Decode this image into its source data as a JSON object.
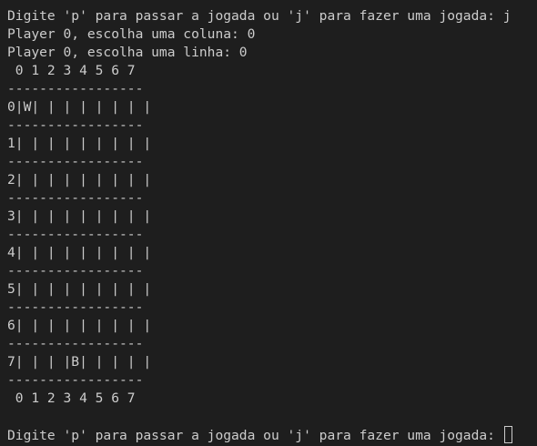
{
  "terminal": {
    "lines": [
      "Digite 'p' para passar a jogada ou 'j' para fazer uma jogada: j",
      "Player 0, escolha uma coluna: 0",
      "Player 0, escolha uma linha: 0",
      " 0 1 2 3 4 5 6 7",
      "-----------------",
      "0|W| | | | | | | |",
      "-----------------",
      "1| | | | | | | | |",
      "-----------------",
      "2| | | | | | | | |",
      "-----------------",
      "3| | | | | | | | |",
      "-----------------",
      "4| | | | | | | | |",
      "-----------------",
      "5| | | | | | | | |",
      "-----------------",
      "6| | | | | | | | |",
      "-----------------",
      "7| | | |B| | | | |",
      "-----------------",
      " 0 1 2 3 4 5 6 7",
      ""
    ],
    "prompt": "Digite 'p' para passar a jogada ou 'j' para fazer uma jogada: "
  }
}
